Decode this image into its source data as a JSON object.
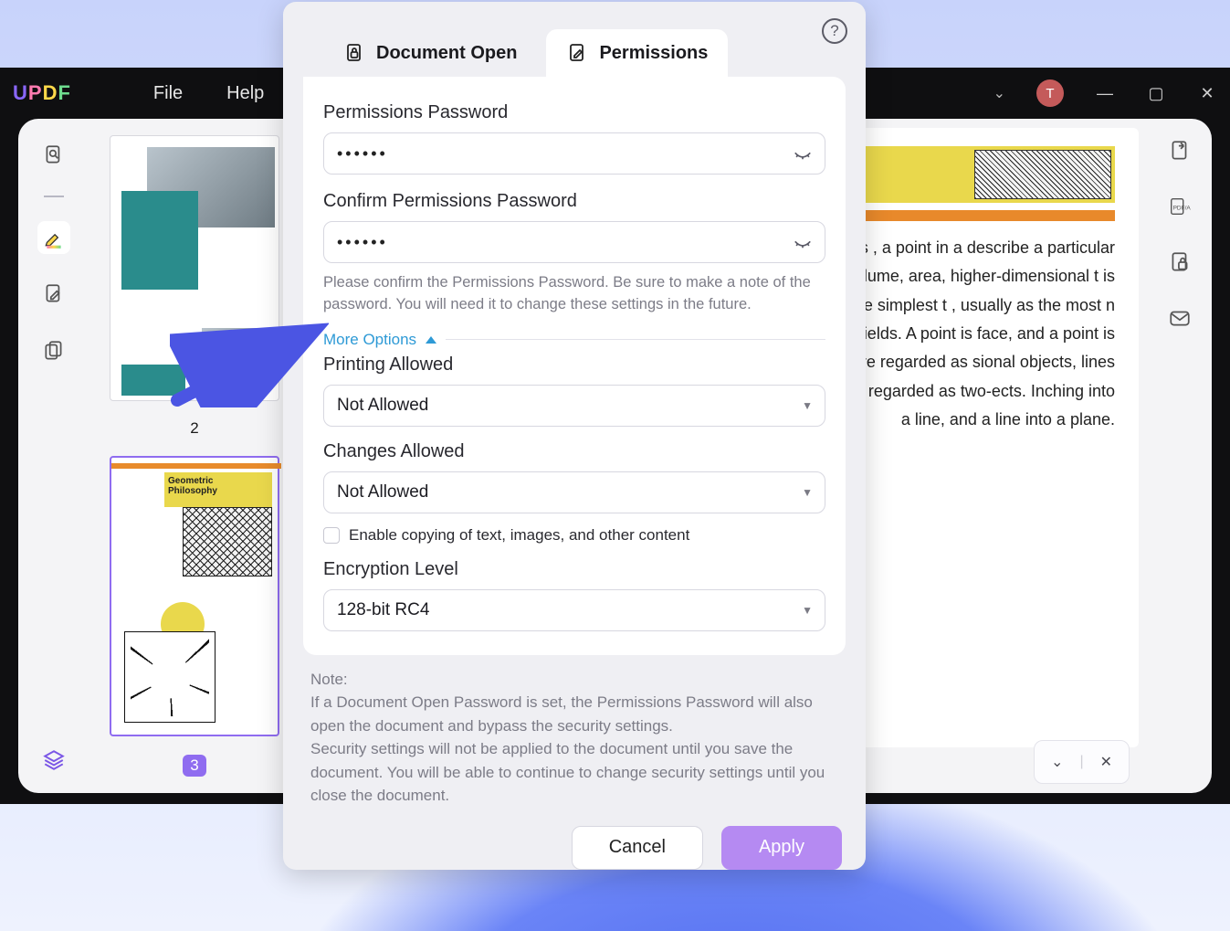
{
  "app": {
    "logo": "UPDF",
    "menu": {
      "file": "File",
      "help": "Help"
    },
    "avatar_initial": "T"
  },
  "thumbs": {
    "n2": "2",
    "n3": "3",
    "t2_title": "Geometric\nPhilosophy"
  },
  "doc": {
    "body": "topology , and related hematics , a point in a describe a particular given space , in which ogies of volume, area, higher-dimensional t is a zero-dimensional he point is the simplest t , usually as the most n geometry, physics, l other fields. A point is face, and a point is mponent in geometry. In points are regarded as sional objects, lines are ne-dimensional objects, es are regarded as two-ects. Inching into a line, and a line into a plane."
  },
  "dialog": {
    "tabs": {
      "open": "Document Open",
      "perm": "Permissions"
    },
    "perm_pw_label": "Permissions Password",
    "perm_pw_value": "••••••",
    "confirm_label": "Confirm Permissions Password",
    "confirm_value": "••••••",
    "confirm_hint": "Please confirm the Permissions Password. Be sure to make a note of the password. You will need it to change these settings in the future.",
    "more": "More Options",
    "printing_label": "Printing Allowed",
    "printing_value": "Not Allowed",
    "changes_label": "Changes Allowed",
    "changes_value": "Not Allowed",
    "copy_label": "Enable copying of text, images, and other content",
    "enc_label": "Encryption Level",
    "enc_value": "128-bit RC4",
    "note_title": "Note:",
    "note_body": "If a Document Open Password is set, the Permissions Password will also open the document and bypass the security settings.\nSecurity settings will not be applied to the document until you save the document. You will be able to continue to change security settings until you close the document.",
    "cancel": "Cancel",
    "apply": "Apply"
  }
}
